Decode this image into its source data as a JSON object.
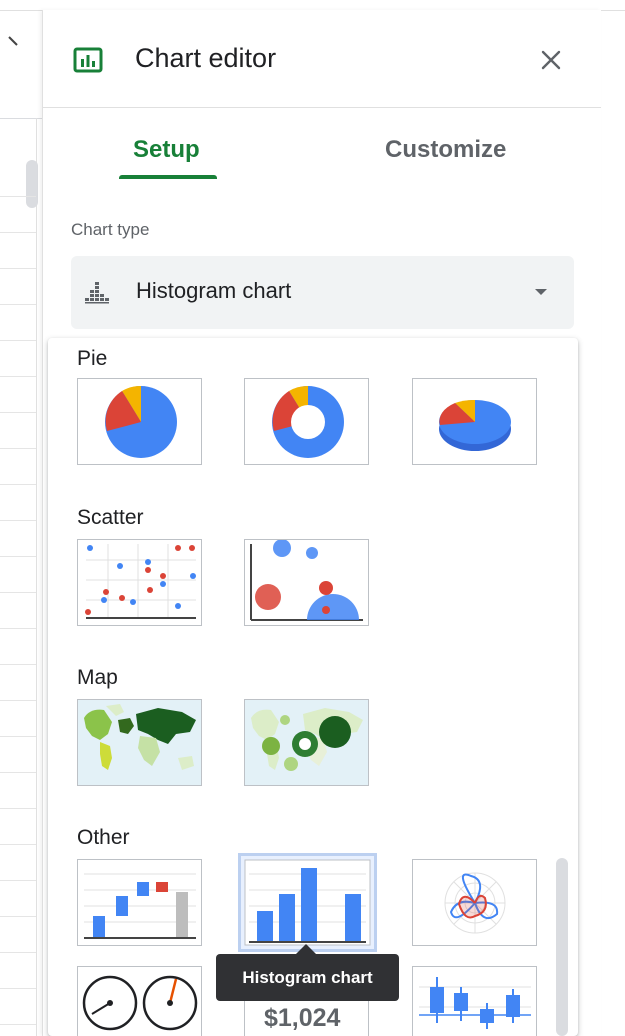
{
  "panel": {
    "title": "Chart editor",
    "tabs": [
      {
        "label": "Setup",
        "active": true
      },
      {
        "label": "Customize",
        "active": false
      }
    ],
    "chart_type_label": "Chart type",
    "selected_chart_type": "Histogram chart",
    "accent_color": "#188038"
  },
  "dropdown": {
    "sections": [
      {
        "title": "Pie",
        "options": [
          "pie-chart",
          "doughnut-chart",
          "3d-pie-chart"
        ]
      },
      {
        "title": "Scatter",
        "options": [
          "scatter-chart",
          "bubble-chart"
        ]
      },
      {
        "title": "Map",
        "options": [
          "geo-chart",
          "geo-chart-with-markers"
        ]
      },
      {
        "title": "Other",
        "options": [
          "waterfall-chart",
          "histogram-chart",
          "radar-chart",
          "gauge-chart",
          "scorecard-chart",
          "candlestick-chart"
        ]
      }
    ],
    "tooltip": "Histogram chart",
    "scorecard_value": "$1,024"
  },
  "colors": {
    "blue": "#4285f4",
    "red": "#db4437",
    "orange": "#f4b400",
    "green": "#0f9d58"
  }
}
